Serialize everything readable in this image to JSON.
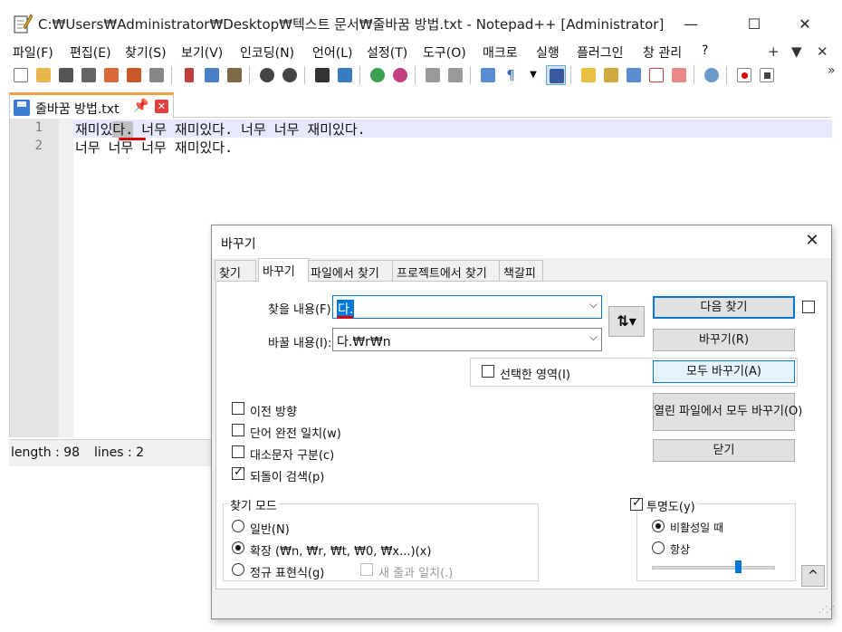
{
  "window": {
    "title": "C:₩Users₩Administrator₩Desktop₩텍스트 문서₩줄바꿈 방법.txt - Notepad++ [Administrator]",
    "minimize": "—",
    "maximize": "☐",
    "close": "✕"
  },
  "menu": {
    "items": [
      "파일(F)",
      "편집(E)",
      "찾기(S)",
      "보기(V)",
      "인코딩(N)",
      "언어(L)",
      "설정(T)",
      "도구(O)",
      "매크로",
      "실행",
      "플러그인",
      "창 관리",
      "?"
    ],
    "right": [
      "+",
      "▼",
      "✕"
    ]
  },
  "toolbar": {
    "more": "»"
  },
  "tab": {
    "label": "줄바꿈 방법.txt",
    "pin": "📌",
    "close": "✕"
  },
  "editor": {
    "line_numbers": [
      "1",
      "2"
    ],
    "line1_before": "재미있",
    "line1_selected": "다.",
    "line1_after": " 너무 재미있다. 너무 너무 재미있다.",
    "line2": "너무 너무 너무 재미있다."
  },
  "status": {
    "length": "length : 98",
    "lines": "lines : 2"
  },
  "dialog": {
    "title": "바꾸기",
    "close": "✕",
    "tabs": [
      "찾기",
      "바꾸기",
      "파일에서 찾기",
      "프로젝트에서 찾기",
      "책갈피"
    ],
    "find_label": "찾을 내용(F):",
    "find_value": "다.",
    "replace_label": "바꿀 내용(I):",
    "replace_value": "다.₩r₩n",
    "swap_symbol": "⇅▾",
    "in_selection_label": "선택한 영역(I)",
    "buttons": {
      "find_next": "다음 찾기",
      "replace": "바꾸기(R)",
      "replace_all": "모두 바꾸기(A)",
      "replace_all_open": "열린 파일에서 모두 바꾸기(O)",
      "close": "닫기"
    },
    "options": {
      "backward": "이전 방향",
      "whole_word": "단어 완전 일치(w)",
      "match_case": "대소문자 구분(c)",
      "wrap_around": "되돌이 검색(p)"
    },
    "search_mode": {
      "title": "찾기 모드",
      "normal": "일반(N)",
      "extended": "확장 (₩n, ₩r, ₩t, ₩0, ₩x...)(x)",
      "regex": "정규 표현식(g)",
      "dot_newline": "새 줄과 일치(.)"
    },
    "transparency": {
      "title": "투명도(y)",
      "on_lose_focus": "비활성일 때",
      "always": "항상",
      "level_fraction": 0.7
    },
    "collapse": "^"
  }
}
